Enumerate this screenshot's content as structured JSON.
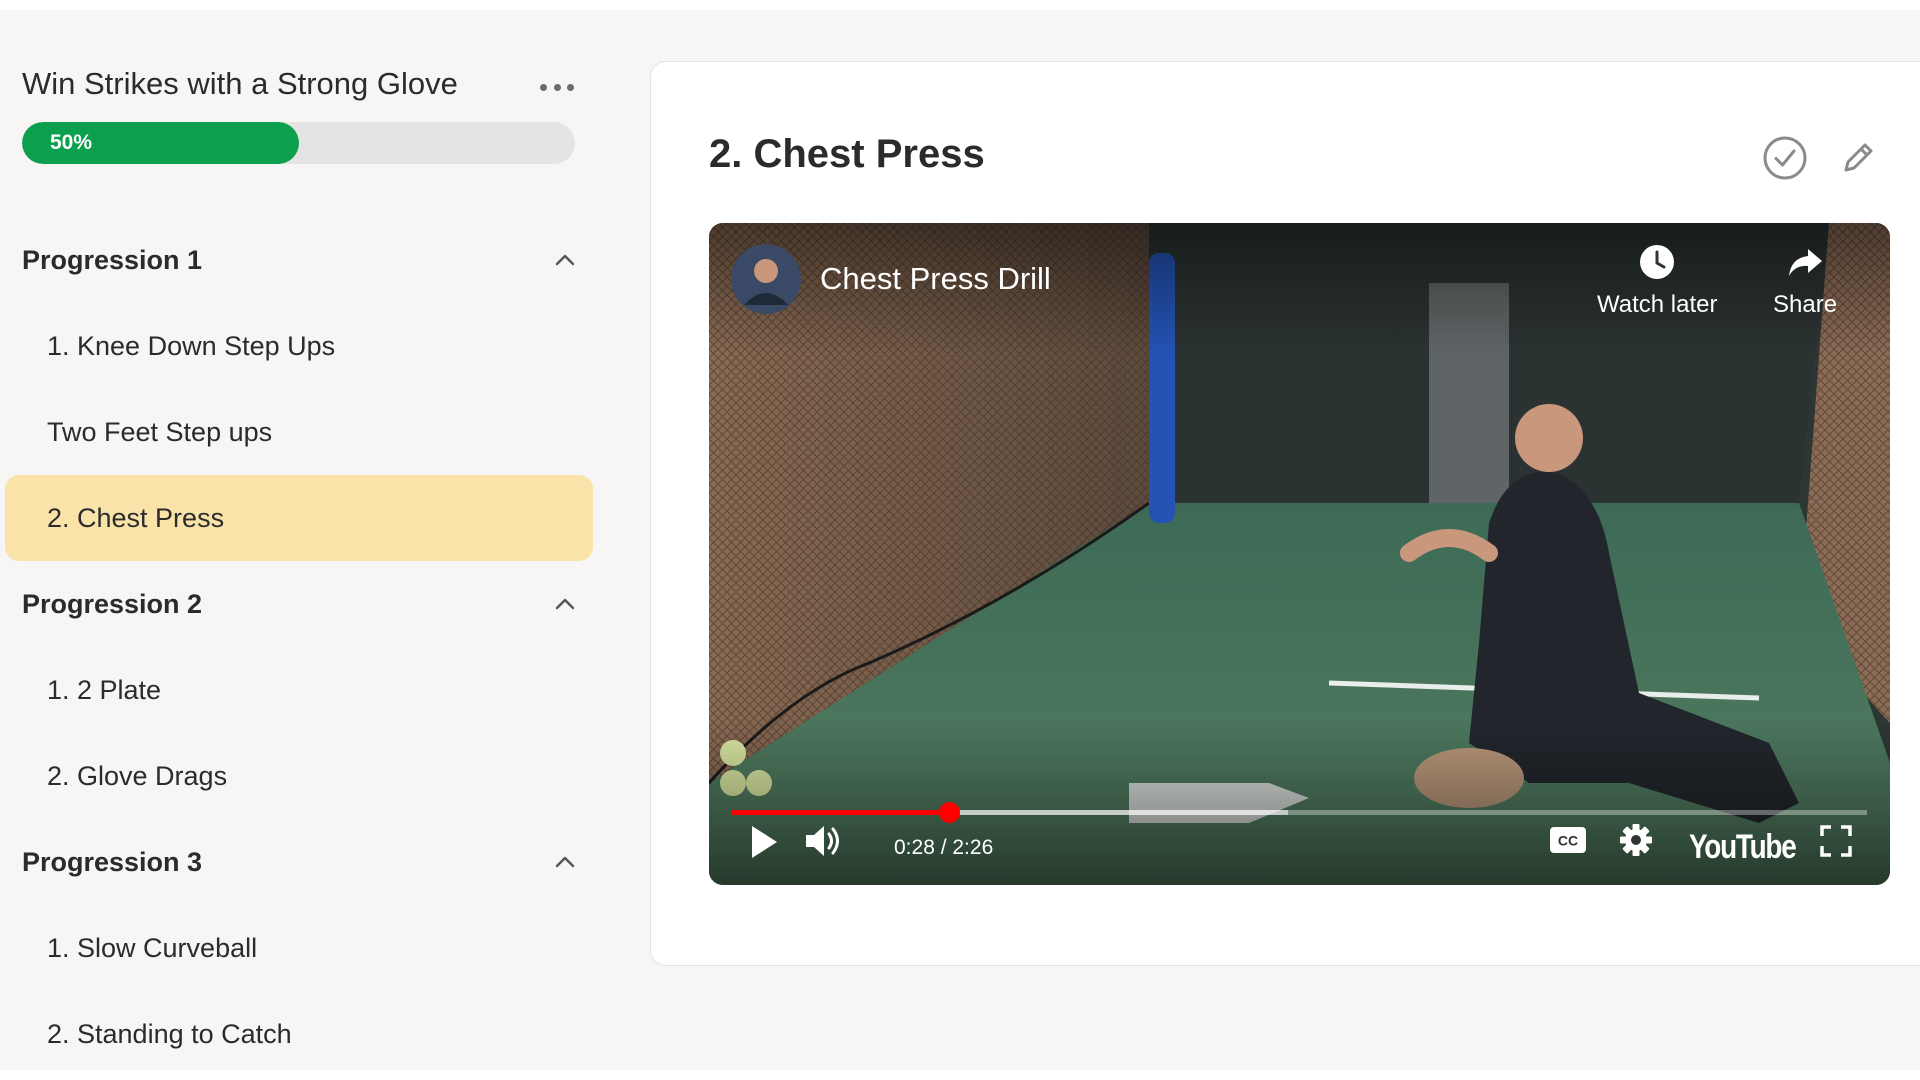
{
  "course": {
    "title": "Win Strikes with a Strong Glove",
    "more_icon": "more-horizontal-icon",
    "progress_label": "50%",
    "progress_fraction": 0.5,
    "progress_color": "#0ca04e"
  },
  "sections": [
    {
      "title": "Progression 1",
      "expanded": true,
      "lessons": [
        {
          "label": "1. Knee Down Step Ups",
          "active": false
        },
        {
          "label": "Two Feet Step ups",
          "active": false
        },
        {
          "label": "2. Chest Press",
          "active": true
        }
      ]
    },
    {
      "title": "Progression 2",
      "expanded": true,
      "lessons": [
        {
          "label": "1. 2 Plate",
          "active": false
        },
        {
          "label": "2. Glove Drags",
          "active": false
        }
      ]
    },
    {
      "title": "Progression 3",
      "expanded": true,
      "lessons": [
        {
          "label": "1. Slow Curveball",
          "active": false
        },
        {
          "label": "2. Standing to Catch",
          "active": false
        }
      ]
    }
  ],
  "lesson": {
    "title": "2. Chest Press",
    "complete_icon": "check-circle-icon",
    "edit_icon": "pencil-icon"
  },
  "video": {
    "title": "Chest Press Drill",
    "watch_later_label": "Watch later",
    "share_label": "Share",
    "time": "0:28 / 2:26",
    "played_fraction": 0.192,
    "buffered_fraction": 0.49,
    "logo_text": "YouTube",
    "accent_color": "#ff0000",
    "highlight_color": "#f9e3a9"
  }
}
